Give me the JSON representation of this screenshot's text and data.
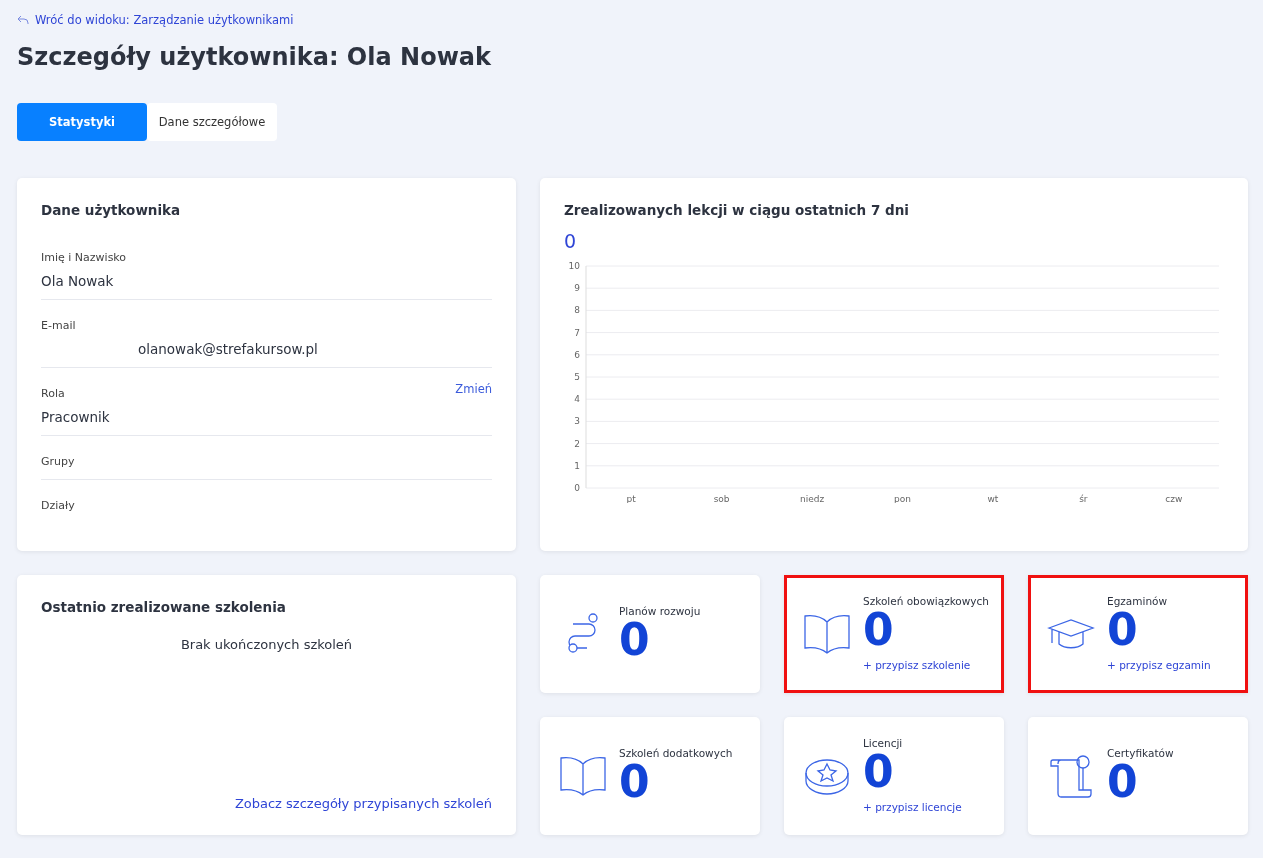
{
  "back_link": "Wróć do widoku: Zarządzanie użytkownikami",
  "title": "Szczegóły użytkownika: Ola Nowak",
  "tabs": [
    {
      "label": "Statystyki",
      "selected": true
    },
    {
      "label": "Dane szczegółowe",
      "selected": false
    }
  ],
  "user_card": {
    "title": "Dane użytkownika",
    "fields": [
      {
        "label": "Imię i Nazwisko",
        "value": "Ola Nowak",
        "indented": false
      },
      {
        "label": "E-mail",
        "value": "olanowak@strefakursow.pl",
        "indented": true
      },
      {
        "label": "Rola",
        "value": "Pracownik",
        "indented": false,
        "action": "Zmień"
      },
      {
        "label": "Grupy"
      },
      {
        "label": "Działy"
      }
    ]
  },
  "lessons_card": {
    "title": "Zrealizowanych lekcji w ciągu ostatnich 7 dni",
    "total": "0",
    "chart_data": {
      "type": "bar",
      "categories": [
        "pt",
        "sob",
        "niedz",
        "pon",
        "wt",
        "śr",
        "czw"
      ],
      "values": [
        0,
        0,
        0,
        0,
        0,
        0,
        0
      ],
      "ylim": [
        0,
        10
      ],
      "grid": true,
      "yticks": [
        0,
        1,
        2,
        3,
        4,
        5,
        6,
        7,
        8,
        9,
        10
      ]
    }
  },
  "recent_card": {
    "title": "Ostatnio zrealizowane szkolenia",
    "empty": "Brak ukończonych szkoleń",
    "link": "Zobacz szczegóły przypisanych szkoleń"
  },
  "stats": [
    {
      "kind": "route",
      "label": "Planów rozwoju",
      "value": "0",
      "highlighted": false
    },
    {
      "kind": "book",
      "label": "Szkoleń obowiązkowych",
      "value": "0",
      "link": "+ przypisz szkolenie",
      "highlighted": true
    },
    {
      "kind": "cap",
      "label": "Egzaminów",
      "value": "0",
      "link": "+ przypisz egzamin",
      "highlighted": true
    },
    {
      "kind": "book",
      "label": "Szkoleń dodatkowych",
      "value": "0",
      "highlighted": false
    },
    {
      "kind": "coin",
      "label": "Licencji",
      "value": "0",
      "link": "+ przypisz licencje",
      "highlighted": false
    },
    {
      "kind": "certificate",
      "label": "Certyfikatów",
      "value": "0",
      "highlighted": false
    }
  ]
}
